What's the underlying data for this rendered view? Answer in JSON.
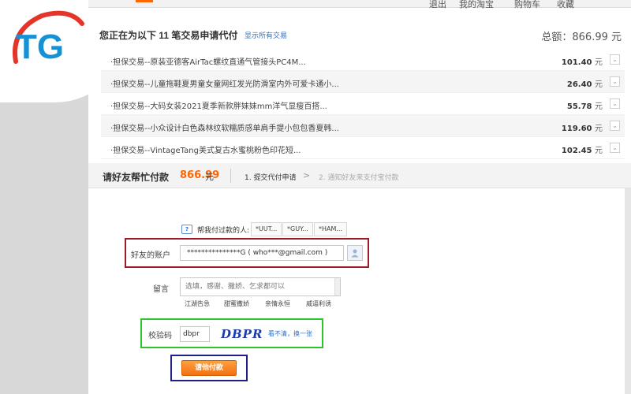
{
  "logo": {
    "text": "TG",
    "colors": {
      "primary": "#1591d6",
      "accent": "#e5352a"
    }
  },
  "topbar": {
    "items": [
      "退出",
      "我的淘宝",
      "购物车",
      "收藏"
    ]
  },
  "header": {
    "title": "您正在为以下 11 笔交易申请代付",
    "show_all_link": "显示所有交易",
    "total_label": "总额：866.99 元"
  },
  "orders": [
    {
      "desc": "·担保交易--原装亚德客AirTac螺纹直通气管接头PC4M...",
      "amount": "101.40",
      "unit": "元"
    },
    {
      "desc": "·担保交易--儿童拖鞋夏男童女童网红发光防滑室内外可爱卡通小...",
      "amount": "26.40",
      "unit": "元"
    },
    {
      "desc": "·担保交易--大码女装2021夏季新款胖妹妹mm洋气显瘦百搭...",
      "amount": "55.78",
      "unit": "元"
    },
    {
      "desc": "·担保交易--小众设计白色森林纹软糯质感单肩手提小包包香夏韩...",
      "amount": "119.60",
      "unit": "元"
    },
    {
      "desc": "·担保交易--VintageTang美式复古水蜜桃粉色印花短...",
      "amount": "102.45",
      "unit": "元"
    }
  ],
  "pay": {
    "label": "请好友帮忙付款",
    "amount": "866.99",
    "unit": "元",
    "step1": "1. 提交代付申请",
    "step_arrow": ">",
    "step2": "2. 通知好友来支付宝付款"
  },
  "form": {
    "history_label": "帮我付过款的人:",
    "history_chips": [
      "*UUT...",
      "*GUY...",
      "*HAM..."
    ],
    "account_label": "好友的账户",
    "account_value": "***************G ( who***@gmail.com )",
    "message_label": "留言",
    "message_placeholder": "选填，感谢、撒娇、乞求都可以",
    "quick_messages": [
      "江湖告急",
      "甜蜜撒娇",
      "亲情永恒",
      "威逼利诱"
    ],
    "captcha_label": "校验码",
    "captcha_value": "dbpr",
    "captcha_image_text": "DBPR",
    "captcha_refresh": "看不清，换一张",
    "submit_label": "请他付款"
  },
  "highlight_colors": {
    "account": "#a0182a",
    "captcha": "#2ec42e",
    "submit": "#1f1f8a"
  }
}
